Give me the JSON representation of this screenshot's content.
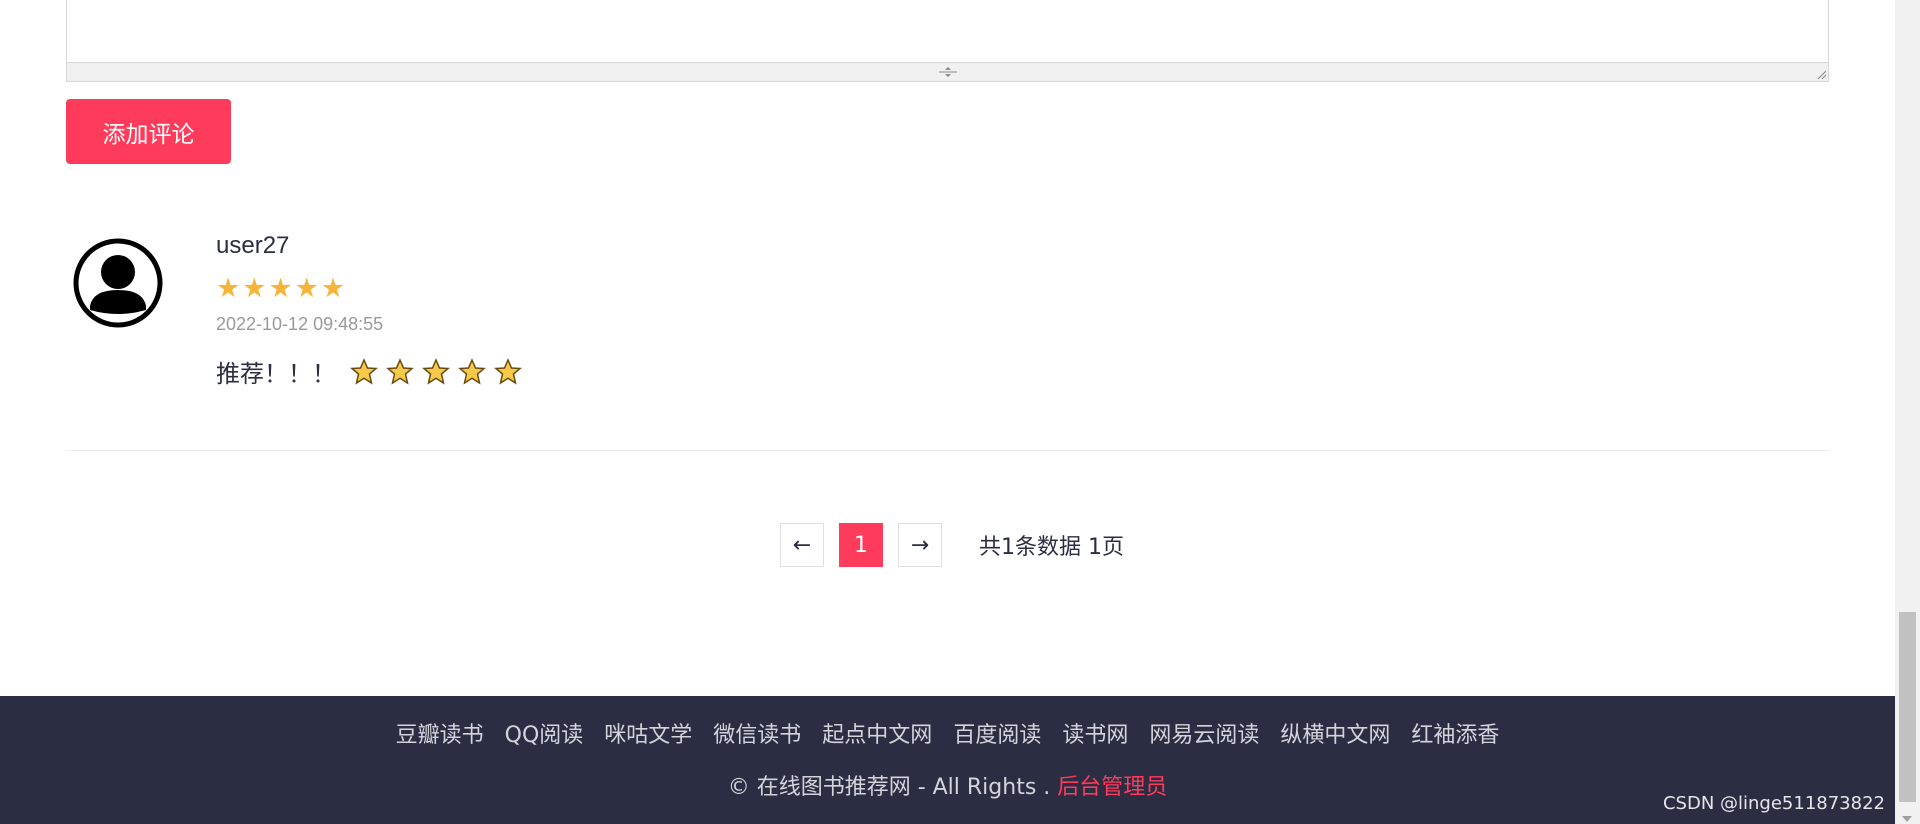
{
  "editor": {
    "resize_icon": "resize-grip-icon"
  },
  "actions": {
    "add_comment_label": "添加评论"
  },
  "comment": {
    "user": "user27",
    "rating": 5,
    "rating_max": 5,
    "timestamp": "2022-10-12 09:48:55",
    "text": "推荐！！！",
    "emoji_count": 5
  },
  "pagination": {
    "prev_label": "←",
    "current_page": "1",
    "next_label": "→",
    "summary": "共1条数据  1页"
  },
  "footer": {
    "links": [
      "豆瓣读书",
      "QQ阅读",
      "咪咕文学",
      "微信读书",
      "起点中文网",
      "百度阅读",
      "读书网",
      "网易云阅读",
      "纵横中文网",
      "红袖添香"
    ],
    "copyright": "© 在线图书推荐网 - All Rights . ",
    "admin_link": "后台管理员"
  },
  "watermark": "CSDN @linge511873822",
  "colors": {
    "accent": "#ff3b5c",
    "footer_bg": "#2b2d42",
    "star": "#f5b53b"
  }
}
